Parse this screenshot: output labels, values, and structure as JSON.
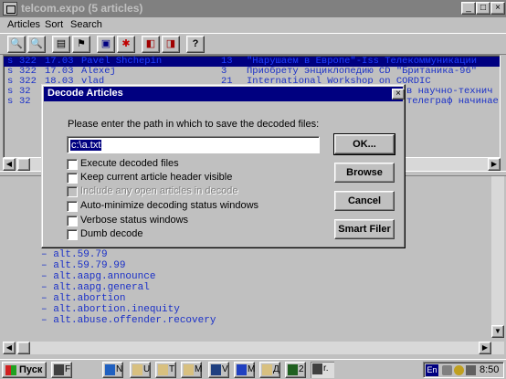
{
  "window": {
    "title": "telcom.expo (5 articles)",
    "controls": {
      "minimize": "_",
      "maximize": "□",
      "close": "×"
    }
  },
  "menu": {
    "articles": "Articles",
    "sort": "Sort",
    "search": "Search"
  },
  "toolbar": {
    "buttons": [
      {
        "name": "search-icon",
        "glyph": "🔍"
      },
      {
        "name": "search-next-icon",
        "glyph": "🔍"
      },
      {
        "name": "article-list-icon",
        "glyph": "▤"
      },
      {
        "name": "filter-icon",
        "glyph": "⚑"
      },
      {
        "name": "save-icon",
        "glyph": "▣"
      },
      {
        "name": "decode-icon",
        "glyph": "✱"
      },
      {
        "name": "prev-group-icon",
        "glyph": "◧"
      },
      {
        "name": "next-group-icon",
        "glyph": "◨"
      },
      {
        "name": "help-icon",
        "glyph": "?"
      }
    ]
  },
  "articles": [
    {
      "flag": "s",
      "num": "322",
      "date": "17.03",
      "author": "Pavel Shchepin",
      "lines": "13",
      "subject": "\"Нарушаем в Европе\"-Iss Телекоммуникации",
      "selected": true
    },
    {
      "flag": "s",
      "num": "322",
      "date": "17.03",
      "author": "Alexej",
      "lines": "3",
      "subject": "Приобрету энциклопедию CD \"Британика-96\"",
      "selected": false
    },
    {
      "flag": "s",
      "num": "322",
      "date": "18.03",
      "author": "vlad",
      "lines": "21",
      "subject": "International Workshop on CORDIC",
      "selected": false
    },
    {
      "flag": "s",
      "num": "32",
      "date": "",
      "author": "",
      "lines": "",
      "subject": "в научно-технич",
      "selected": false
    },
    {
      "flag": "s",
      "num": "32",
      "date": "",
      "author": "",
      "lines": "",
      "subject": "телеграф начинае",
      "selected": false
    }
  ],
  "groups": [
    "– alt.59.79",
    "– alt.59.79.99",
    "– alt.aapg.announce",
    "– alt.aapg.general",
    "– alt.abortion",
    "– alt.abortion.inequity",
    "– alt.abuse.offender.recovery"
  ],
  "dialog": {
    "title": "Decode Articles",
    "prompt": "Please enter the path in which to save the decoded files:",
    "path_value": "c:\\a.txt",
    "checkboxes": [
      {
        "label": "Execute decoded files",
        "checked": false,
        "enabled": true
      },
      {
        "label": "Keep current article header visible",
        "checked": false,
        "enabled": true
      },
      {
        "label": "Include any open articles in decode",
        "checked": false,
        "enabled": false
      },
      {
        "label": "Auto-minimize decoding status windows",
        "checked": false,
        "enabled": true
      },
      {
        "label": "Verbose status windows",
        "checked": false,
        "enabled": true
      },
      {
        "label": "Dumb decode",
        "checked": false,
        "enabled": true
      }
    ],
    "buttons": {
      "ok": "OK...",
      "browse": "Browse",
      "cancel": "Cancel",
      "smart_filer": "Smart Filer"
    },
    "close": "×"
  },
  "taskbar": {
    "start": "Пуск",
    "tasks": [
      {
        "name": "task-1",
        "label": "F",
        "color": "#404040"
      },
      {
        "name": "task-2",
        "label": "N",
        "color": "#2060c0"
      },
      {
        "name": "task-3",
        "label": "U",
        "color": "#a08040"
      },
      {
        "name": "task-4",
        "label": "T",
        "color": "#a08040"
      },
      {
        "name": "task-5",
        "label": "M",
        "color": "#a08040"
      },
      {
        "name": "task-6",
        "label": "V",
        "color": "#204080"
      },
      {
        "name": "task-7",
        "label": "M",
        "color": "#2040c0"
      },
      {
        "name": "task-8",
        "label": "Д",
        "color": "#a08040"
      },
      {
        "name": "task-9",
        "label": "2",
        "color": "#206020"
      },
      {
        "name": "task-10",
        "label": "r.",
        "color": "#404040"
      }
    ],
    "tray": {
      "lang": "En",
      "clock": "8:50"
    }
  }
}
